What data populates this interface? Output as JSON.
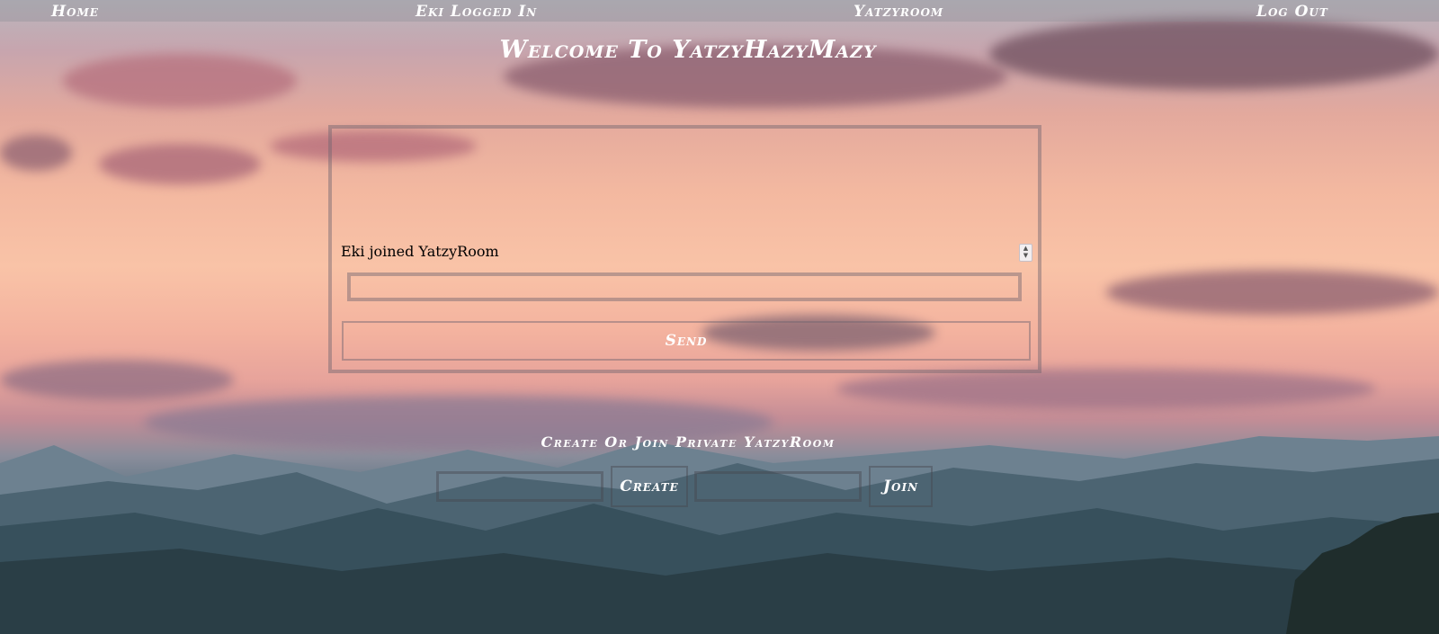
{
  "nav": {
    "home": "Home",
    "logged_in": "Eki Logged In",
    "room": "Yatzyroom",
    "logout": "Log Out"
  },
  "title": "Welcome To YatzyHazyMazy",
  "chat": {
    "messages": [
      "Eki joined YatzyRoom"
    ],
    "input_value": "",
    "send_label": "Send"
  },
  "private_room": {
    "heading": "Create Or Join Private YatzyRoom",
    "create_input_value": "",
    "create_label": "Create",
    "join_input_value": "",
    "join_label": "Join"
  },
  "colors": {
    "text": "#ffffff",
    "sky_top": "#b9b6bd",
    "sky_mid": "#f9c3a7",
    "mountains": "#2b3e45"
  }
}
